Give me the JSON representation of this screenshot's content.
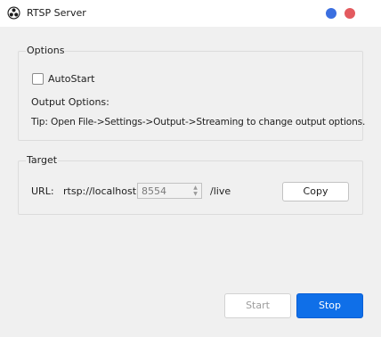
{
  "window": {
    "title": "RTSP Server",
    "app_icon": "obs-logo-icon",
    "controls": [
      "minimize-icon",
      "close-icon"
    ],
    "control_colors": {
      "minimize": "#3b6fe0",
      "close": "#e35a5f"
    }
  },
  "options": {
    "group_title": "Options",
    "autostart_label": "AutoStart",
    "autostart_checked": false,
    "output_options_label": "Output Options:",
    "tip": "Tip: Open File->Settings->Output->Streaming to change output options."
  },
  "target": {
    "group_title": "Target",
    "url_label": "URL:",
    "url_prefix": "rtsp://localhost:",
    "port": "8554",
    "url_suffix": "/live",
    "copy_label": "Copy"
  },
  "actions": {
    "start_label": "Start",
    "stop_label": "Stop",
    "accent_color": "#0f6fe8"
  }
}
